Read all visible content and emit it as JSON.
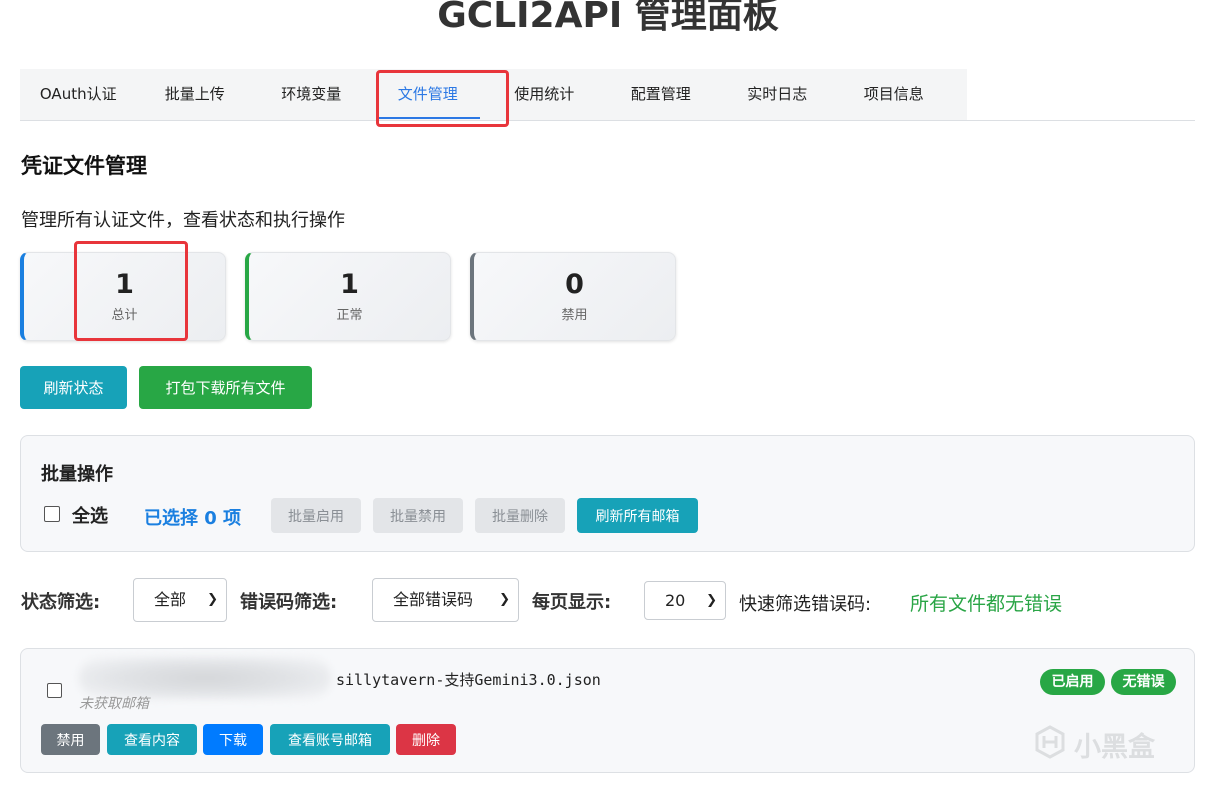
{
  "page": {
    "title": "GCLI2API 管理面板"
  },
  "tabs": [
    {
      "label": "OAuth认证"
    },
    {
      "label": "批量上传"
    },
    {
      "label": "环境变量"
    },
    {
      "label": "文件管理",
      "active": true
    },
    {
      "label": "使用统计"
    },
    {
      "label": "配置管理"
    },
    {
      "label": "实时日志"
    },
    {
      "label": "项目信息"
    }
  ],
  "section": {
    "title": "凭证文件管理",
    "description": "管理所有认证文件，查看状态和执行操作"
  },
  "stats": [
    {
      "value": "1",
      "label": "总计",
      "accent": "#1a7fe0"
    },
    {
      "value": "1",
      "label": "正常",
      "accent": "#28a745"
    },
    {
      "value": "0",
      "label": "禁用",
      "accent": "#6c757d"
    }
  ],
  "actions": {
    "refresh": "刷新状态",
    "download_all": "打包下载所有文件"
  },
  "batch": {
    "title": "批量操作",
    "select_all": "全选",
    "selected": "已选择 0 项",
    "enable": "批量启用",
    "disable": "批量禁用",
    "delete": "批量删除",
    "refresh_emails": "刷新所有邮箱"
  },
  "filters": {
    "status_label": "状态筛选:",
    "status_value": "全部",
    "error_label": "错误码筛选:",
    "error_value": "全部错误码",
    "page_size_label": "每页显示:",
    "page_size_value": "20",
    "quick_label": "快速筛选错误码:",
    "quick_status": "所有文件都无错误"
  },
  "files": [
    {
      "name": "sillytavern-支持Gemini3.0.json",
      "email_status": "未获取邮箱",
      "badges": [
        "已启用",
        "无错误"
      ],
      "buttons": {
        "disable": "禁用",
        "view": "查看内容",
        "download": "下载",
        "view_email": "查看账号邮箱",
        "delete": "删除"
      }
    }
  ],
  "watermark": {
    "text": "小黑盒"
  },
  "colors": {
    "accent_blue": "#2b78e4",
    "teal": "#17a2b8",
    "green": "#28a745",
    "red": "#dc3545",
    "highlight_red": "#e8353b"
  }
}
